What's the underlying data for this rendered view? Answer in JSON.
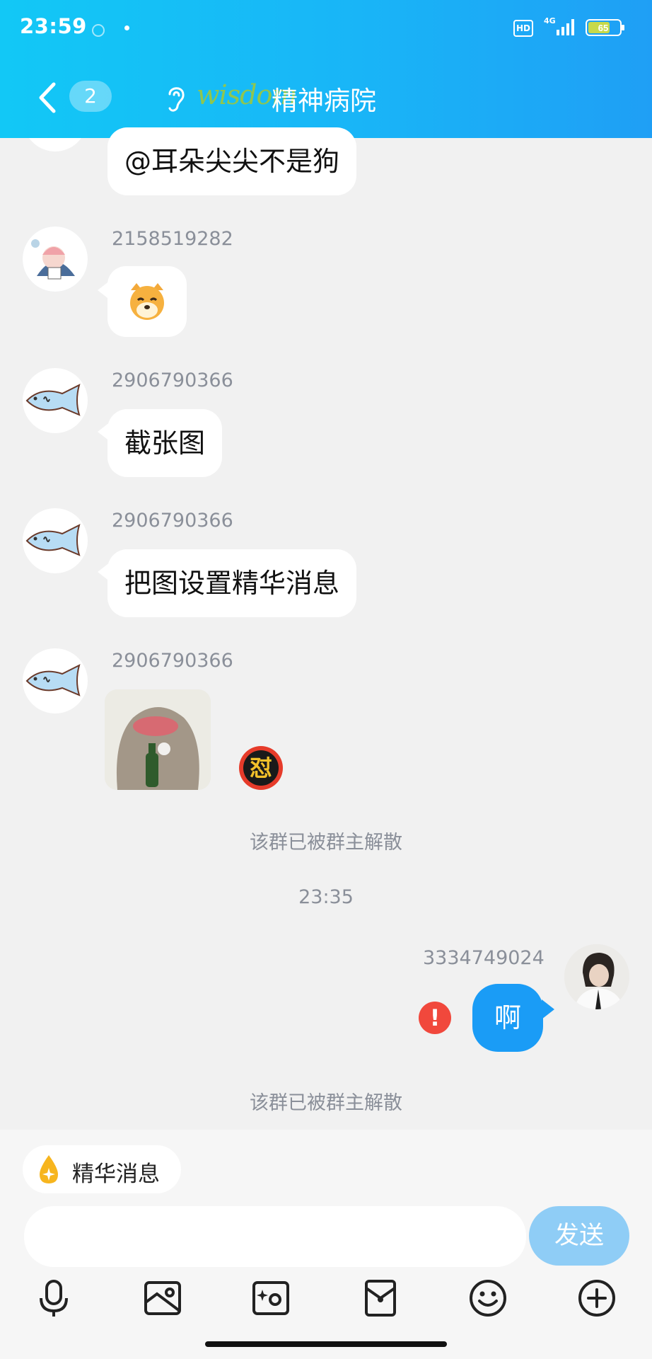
{
  "status_bar": {
    "time": "23:59",
    "hd": "HD",
    "network": "4G",
    "battery": "65"
  },
  "header": {
    "unread_count": "2",
    "title_logo_text": "wisdom",
    "title": "精神病院"
  },
  "messages": [
    {
      "sender": "",
      "text": "@耳朵尖尖不是狗"
    },
    {
      "sender": "2158519282",
      "sticker": "shiba-dog-emoji"
    },
    {
      "sender": "2906790366",
      "text": "截张图"
    },
    {
      "sender": "2906790366",
      "text": "把图设置精华消息"
    },
    {
      "sender": "2906790366",
      "image": "otter-sticker",
      "reaction_icon": "angry-reaction",
      "reaction_glyph": "怼"
    }
  ],
  "system": {
    "disbanded_1": "该群已被群主解散",
    "timestamp": "23:35",
    "disbanded_2": "该群已被群主解散"
  },
  "my_message": {
    "sender": "3334749024",
    "text": "啊",
    "error_glyph": "!"
  },
  "composer": {
    "essence_label": "精华消息",
    "input_value": "",
    "send_label": "发送"
  },
  "toolbar_icons": [
    "microphone-icon",
    "image-icon",
    "camera-icon",
    "red-packet-icon",
    "emoji-icon",
    "plus-icon"
  ],
  "colors": {
    "header_start": "#12c8f6",
    "header_end": "#1f9ff5",
    "my_bubble": "#1a9cf6",
    "send_button": "#8fcdf6",
    "error": "#f1483c",
    "sender_text": "#8a8f99"
  }
}
